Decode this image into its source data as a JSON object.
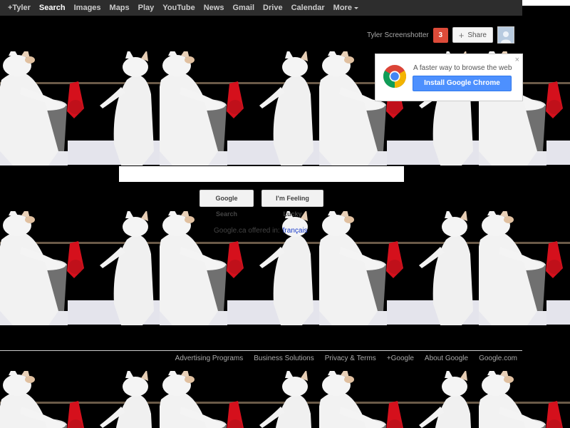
{
  "topbar": {
    "items": [
      {
        "label": "+Tyler",
        "active": false
      },
      {
        "label": "Search",
        "active": true
      },
      {
        "label": "Images",
        "active": false
      },
      {
        "label": "Maps",
        "active": false
      },
      {
        "label": "Play",
        "active": false
      },
      {
        "label": "YouTube",
        "active": false
      },
      {
        "label": "News",
        "active": false
      },
      {
        "label": "Gmail",
        "active": false
      },
      {
        "label": "Drive",
        "active": false
      },
      {
        "label": "Calendar",
        "active": false
      }
    ],
    "more_label": "More"
  },
  "account": {
    "name": "Tyler Screenshotter",
    "notification_count": "3",
    "share_label": "Share",
    "avatar_icon": "avatar-icon"
  },
  "promo": {
    "text": "A faster way to browse the web",
    "install_label": "Install Google Chrome",
    "close_label": "×",
    "logo_icon": "chrome-logo-icon"
  },
  "search": {
    "value": "",
    "search_button": "Google Search",
    "lucky_button": "I'm Feeling Lucky"
  },
  "offered": {
    "text": "Google.ca offered in:",
    "language": "français"
  },
  "footer": {
    "links": [
      "Advertising Programs",
      "Business Solutions",
      "Privacy & Terms",
      "+Google",
      "About Google",
      "Google.com"
    ]
  },
  "colors": {
    "topbar": "#2d2d2d",
    "notification": "#dd4b39",
    "install_button": "#4d90fe",
    "background": "#000000"
  }
}
